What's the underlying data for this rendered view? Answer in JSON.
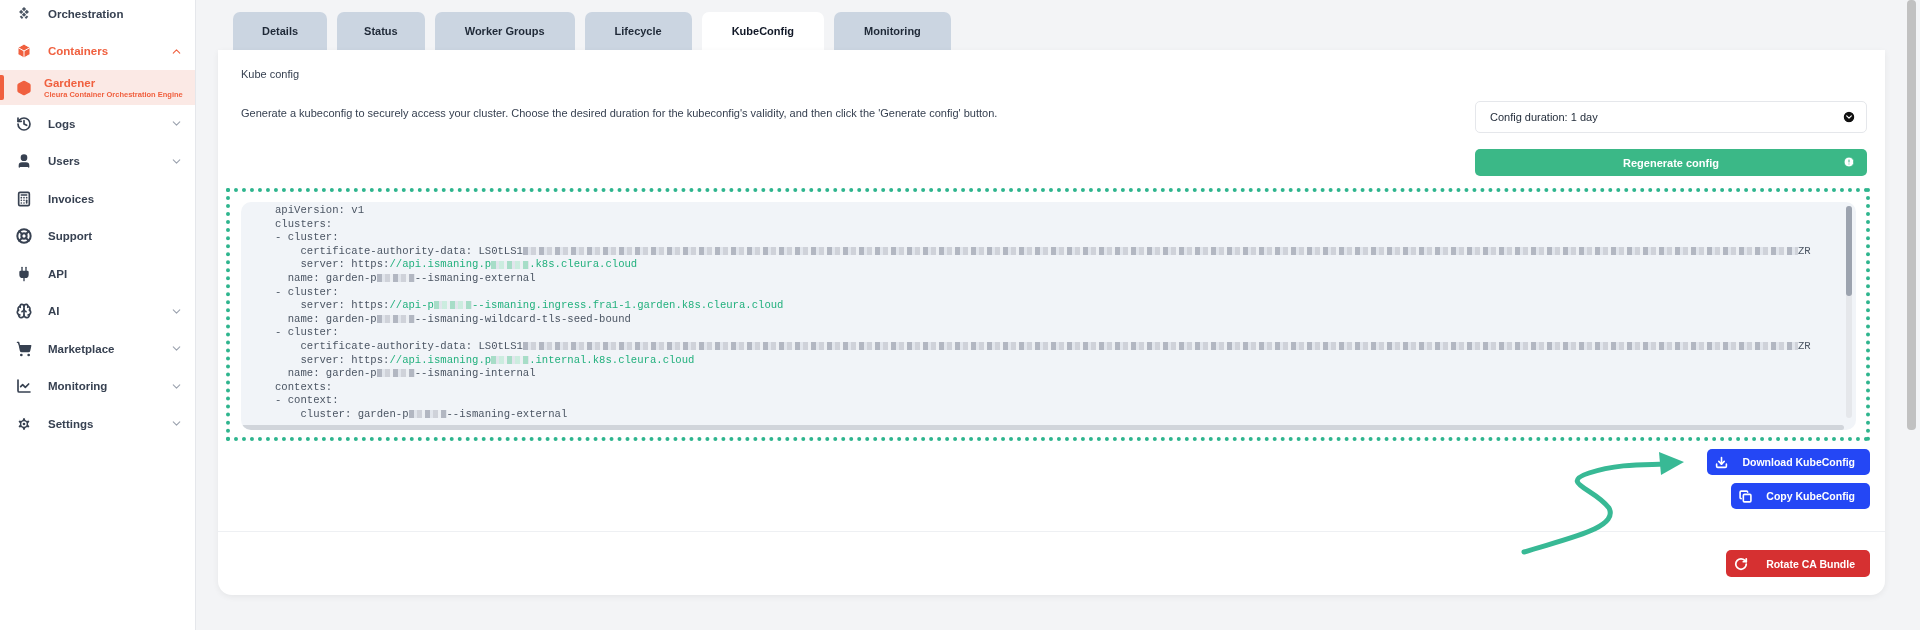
{
  "sidebar": {
    "items": [
      {
        "label": "Orchestration"
      },
      {
        "label": "Containers",
        "expanded": true,
        "children": [
          {
            "label": "Gardener",
            "subtitle": "Cleura Container Orchestration Engine",
            "selected": true
          }
        ]
      },
      {
        "label": "Logs",
        "expanded": false
      },
      {
        "label": "Users",
        "expanded": false
      },
      {
        "label": "Invoices"
      },
      {
        "label": "Support"
      },
      {
        "label": "API"
      },
      {
        "label": "AI",
        "expanded": false
      },
      {
        "label": "Marketplace",
        "expanded": false
      },
      {
        "label": "Monitoring",
        "expanded": false
      },
      {
        "label": "Settings",
        "expanded": false
      }
    ]
  },
  "tabs": [
    {
      "label": "Details",
      "selected": false
    },
    {
      "label": "Status",
      "selected": false
    },
    {
      "label": "Worker Groups",
      "selected": false
    },
    {
      "label": "Lifecycle",
      "selected": false
    },
    {
      "label": "KubeConfig",
      "selected": true
    },
    {
      "label": "Monitoring",
      "selected": false
    }
  ],
  "kubeconfig": {
    "title": "Kube config",
    "description": "Generate a kubeconfig to securely access your cluster. Choose the desired duration for the kubeconfig's validity, and then click the 'Generate config' button.",
    "duration_select": {
      "value": "Config duration: 1 day"
    },
    "regenerate_button": "Regenerate config",
    "code_lines": [
      {
        "segments": [
          {
            "kind": "text",
            "text": "apiVersion: v1"
          }
        ]
      },
      {
        "segments": [
          {
            "kind": "text",
            "text": "clusters:"
          }
        ]
      },
      {
        "segments": [
          {
            "kind": "text",
            "text": "- cluster:"
          }
        ]
      },
      {
        "segments": [
          {
            "kind": "text",
            "text": "    certificate-authority-data: LS0tLS1"
          },
          {
            "kind": "redacted-long"
          },
          {
            "kind": "text",
            "text": "ZR"
          }
        ]
      },
      {
        "segments": [
          {
            "kind": "text",
            "text": "    server: https:"
          },
          {
            "kind": "url",
            "text": "//api.ismaning.p"
          },
          {
            "kind": "redacted-url"
          },
          {
            "kind": "url",
            "text": ".k8s.cleura.cloud"
          }
        ]
      },
      {
        "segments": [
          {
            "kind": "text",
            "text": "  name: garden-p"
          },
          {
            "kind": "redacted"
          },
          {
            "kind": "text",
            "text": "--ismaning-external"
          }
        ]
      },
      {
        "segments": [
          {
            "kind": "text",
            "text": "- cluster:"
          }
        ]
      },
      {
        "segments": [
          {
            "kind": "text",
            "text": "    server: https:"
          },
          {
            "kind": "url",
            "text": "//api-p"
          },
          {
            "kind": "redacted-url"
          },
          {
            "kind": "url",
            "text": "--ismaning.ingress.fra1-1.garden.k8s.cleura.cloud"
          }
        ]
      },
      {
        "segments": [
          {
            "kind": "text",
            "text": "  name: garden-p"
          },
          {
            "kind": "redacted"
          },
          {
            "kind": "text",
            "text": "--ismaning-wildcard-tls-seed-bound"
          }
        ]
      },
      {
        "segments": [
          {
            "kind": "text",
            "text": "- cluster:"
          }
        ]
      },
      {
        "segments": [
          {
            "kind": "text",
            "text": "    certificate-authority-data: LS0tLS1"
          },
          {
            "kind": "redacted-long"
          },
          {
            "kind": "text",
            "text": "ZR"
          }
        ]
      },
      {
        "segments": [
          {
            "kind": "text",
            "text": "    server: https:"
          },
          {
            "kind": "url",
            "text": "//api.ismaning.p"
          },
          {
            "kind": "redacted-url"
          },
          {
            "kind": "url",
            "text": ".internal.k8s.cleura.cloud"
          }
        ]
      },
      {
        "segments": [
          {
            "kind": "text",
            "text": "  name: garden-p"
          },
          {
            "kind": "redacted"
          },
          {
            "kind": "text",
            "text": "--ismaning-internal"
          }
        ]
      },
      {
        "segments": [
          {
            "kind": "text",
            "text": "contexts:"
          }
        ]
      },
      {
        "segments": [
          {
            "kind": "text",
            "text": "- context:"
          }
        ]
      },
      {
        "segments": [
          {
            "kind": "text",
            "text": "    cluster: garden-p"
          },
          {
            "kind": "redacted"
          },
          {
            "kind": "text",
            "text": "--ismaning-external"
          }
        ]
      }
    ],
    "download_button": "Download KubeConfig",
    "copy_button": "Copy KubeConfig"
  },
  "rotate_button": "Rotate CA Bundle"
}
